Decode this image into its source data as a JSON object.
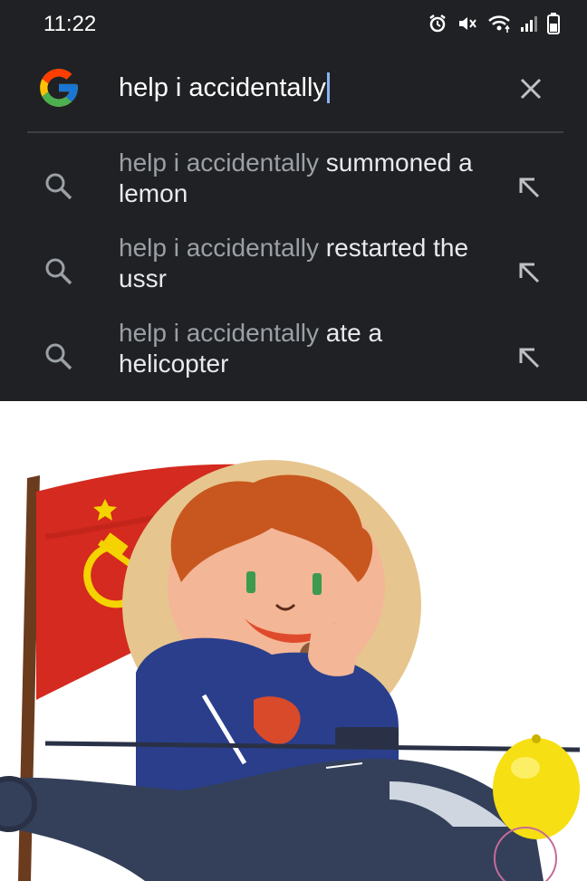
{
  "status_bar": {
    "time": "11:22",
    "icons": [
      "alarm-icon",
      "mute-icon",
      "wifi-icon",
      "signal-icon",
      "battery-icon"
    ]
  },
  "search": {
    "query": "help i accidentally",
    "logo": "google-g-icon",
    "clear_icon": "close-icon"
  },
  "suggestions": [
    {
      "prefix": "help i accidentally",
      "completion_line1": " summoned a",
      "completion_line2": "lemon",
      "icon": "search-icon",
      "action_icon": "arrow-up-left-icon"
    },
    {
      "prefix": "help i accidentally",
      "completion_line1": " restarted the",
      "completion_line2": "ussr",
      "icon": "search-icon",
      "action_icon": "arrow-up-left-icon"
    },
    {
      "prefix": "help i accidentally",
      "completion_line1": " ate a",
      "completion_line2": "helicopter",
      "icon": "search-icon",
      "action_icon": "arrow-up-left-icon"
    }
  ],
  "meme_image": {
    "elements": [
      "soviet-flag",
      "hammer-sickle-emblem",
      "cartoon-boy-eating",
      "helicopter",
      "lemon"
    ],
    "colors": {
      "flag": "#d42a1f",
      "emblem": "#f5d300",
      "lemon": "#f6df12",
      "helicopter": "#34405a"
    }
  }
}
